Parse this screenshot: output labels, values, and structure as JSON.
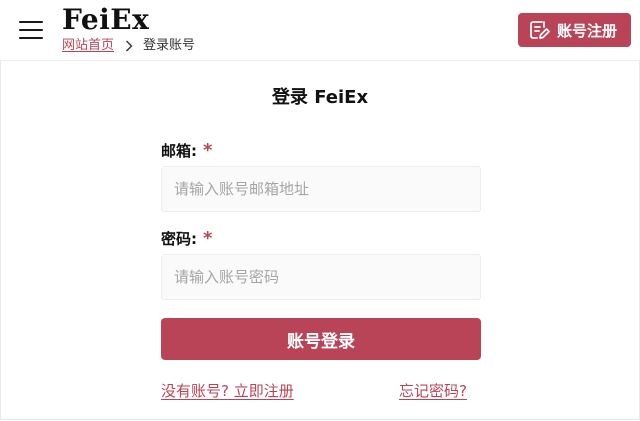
{
  "header": {
    "logo": "FeiEx",
    "breadcrumb": {
      "home": "网站首页",
      "current": "登录账号"
    },
    "register_label": "账号注册"
  },
  "form": {
    "title": "登录 FeiEx",
    "email": {
      "label": "邮箱:",
      "required_mark": "*",
      "placeholder": "请输入账号邮箱地址"
    },
    "password": {
      "label": "密码:",
      "required_mark": "*",
      "placeholder": "请输入账号密码"
    },
    "submit_label": "账号登录",
    "no_account_link": "没有账号? 立即注册",
    "forgot_link": "忘记密码? "
  },
  "colors": {
    "accent": "#b94457",
    "input_bg": "#fafafa"
  },
  "icons": {
    "menu": "hamburger-icon",
    "breadcrumb_sep": "chevron-right-icon",
    "register": "edit-document-icon"
  }
}
